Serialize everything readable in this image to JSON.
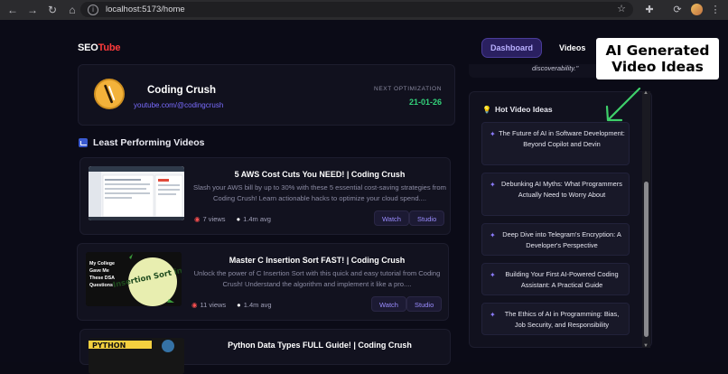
{
  "browser": {
    "url": "localhost:5173/home"
  },
  "header": {
    "logo_seo": "SEO",
    "logo_tube": "Tube",
    "tabs": [
      {
        "label": "Dashboard",
        "active": true
      },
      {
        "label": "Videos",
        "active": false
      }
    ]
  },
  "profile": {
    "name": "Coding Crush",
    "link": "youtube.com/@codingcrush",
    "next_label": "NEXT OPTIMIZATION",
    "next_date": "21-01-26"
  },
  "least_performing": {
    "title": "Least Performing Videos",
    "videos": [
      {
        "title": "5 AWS Cost Cuts You NEED! | Coding Crush",
        "description": "Slash your AWS bill by up to 30% with these 5 essential cost-saving strategies from Coding Crush! Learn actionable hacks to optimize your cloud spend....",
        "views": "7 views",
        "avg": "1.4m avg",
        "watch": "Watch",
        "studio": "Studio"
      },
      {
        "title": "Master C Insertion Sort FAST! | Coding Crush",
        "description": "Unlock the power of C Insertion Sort with this quick and easy tutorial from Coding Crush! Understand the algorithm and implement it like a pro....",
        "views": "11 views",
        "avg": "1.4m avg",
        "watch": "Watch",
        "studio": "Studio",
        "thumb_text_left": "My College Gave Me These DSA Questions",
        "thumb_text_right": "Insertion Sort in C"
      },
      {
        "title": "Python Data Types FULL Guide! | Coding Crush",
        "thumb_text": "PYTHON"
      }
    ]
  },
  "right_panel": {
    "fragment": "discoverability.\""
  },
  "hot_ideas": {
    "title": "Hot Video Ideas",
    "items": [
      "The Future of AI in Software Development: Beyond Copilot and Devin",
      "Debunking AI Myths: What Programmers Actually Need to Worry About",
      "Deep Dive into Telegram's Encryption: A Developer's Perspective",
      "Building Your First AI-Powered Coding Assistant: A Practical Guide",
      "The Ethics of AI in Programming: Bias, Job Security, and Responsibility"
    ]
  },
  "callout": {
    "line1": "AI Generated",
    "line2": "Video Ideas"
  },
  "colors": {
    "accent": "#7a6cff",
    "brand_red": "#ff3b3b",
    "success": "#33d17a"
  }
}
